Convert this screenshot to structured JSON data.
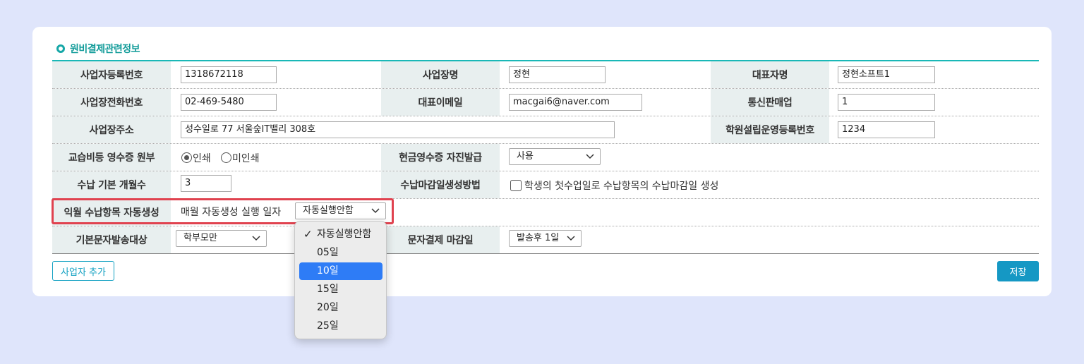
{
  "section_title": "원비결제관련정보",
  "rows": {
    "r1": {
      "h1": "사업자등록번호",
      "v1": "1318672118",
      "h2": "사업장명",
      "v2": "정현",
      "h3": "대표자명",
      "v3": "정현소프트1"
    },
    "r2": {
      "h1": "사업장전화번호",
      "v1": "02-469-5480",
      "h2": "대표이메일",
      "v2": "macgai6@naver.com",
      "h3": "통신판매업",
      "v3": "1"
    },
    "r3": {
      "h1": "사업장주소",
      "v1": "성수일로 77 서울숲IT밸리 308호",
      "h3": "학원설립운영등록번호",
      "v3": "1234"
    },
    "r4": {
      "h1": "교습비등 영수증 원부",
      "radio1": "인쇄",
      "radio2": "미인쇄",
      "radio_selected": "인쇄",
      "h2": "현금영수증 자진발급",
      "select2": "사용"
    },
    "r5": {
      "h1": "수납 기본 개월수",
      "v1": "3",
      "h2": "수납마감일생성방법",
      "checkbox_label": "학생의 첫수업일로 수납항목의 수납마감일 생성",
      "checkbox_checked": false
    },
    "r6": {
      "h1": "익월 수납항목 자동생성",
      "label": "매월 자동생성 실행 일자",
      "select": "자동실행안함"
    },
    "r7": {
      "h1": "기본문자발송대상",
      "select1": "학부모만",
      "h2": "문자결제 마감일",
      "select2": "발송후 1일"
    }
  },
  "dropdown": {
    "options": [
      "자동실행안함",
      "05일",
      "10일",
      "15일",
      "20일",
      "25일"
    ],
    "checked": "자동실행안함",
    "highlighted": "10일"
  },
  "buttons": {
    "add_business": "사업자 추가",
    "save": "저장"
  },
  "colors": {
    "accent": "#1ab8b7",
    "highlight_border": "#e0424f",
    "save_button": "#1598c4",
    "dropdown_highlight": "#2e7cf6"
  }
}
